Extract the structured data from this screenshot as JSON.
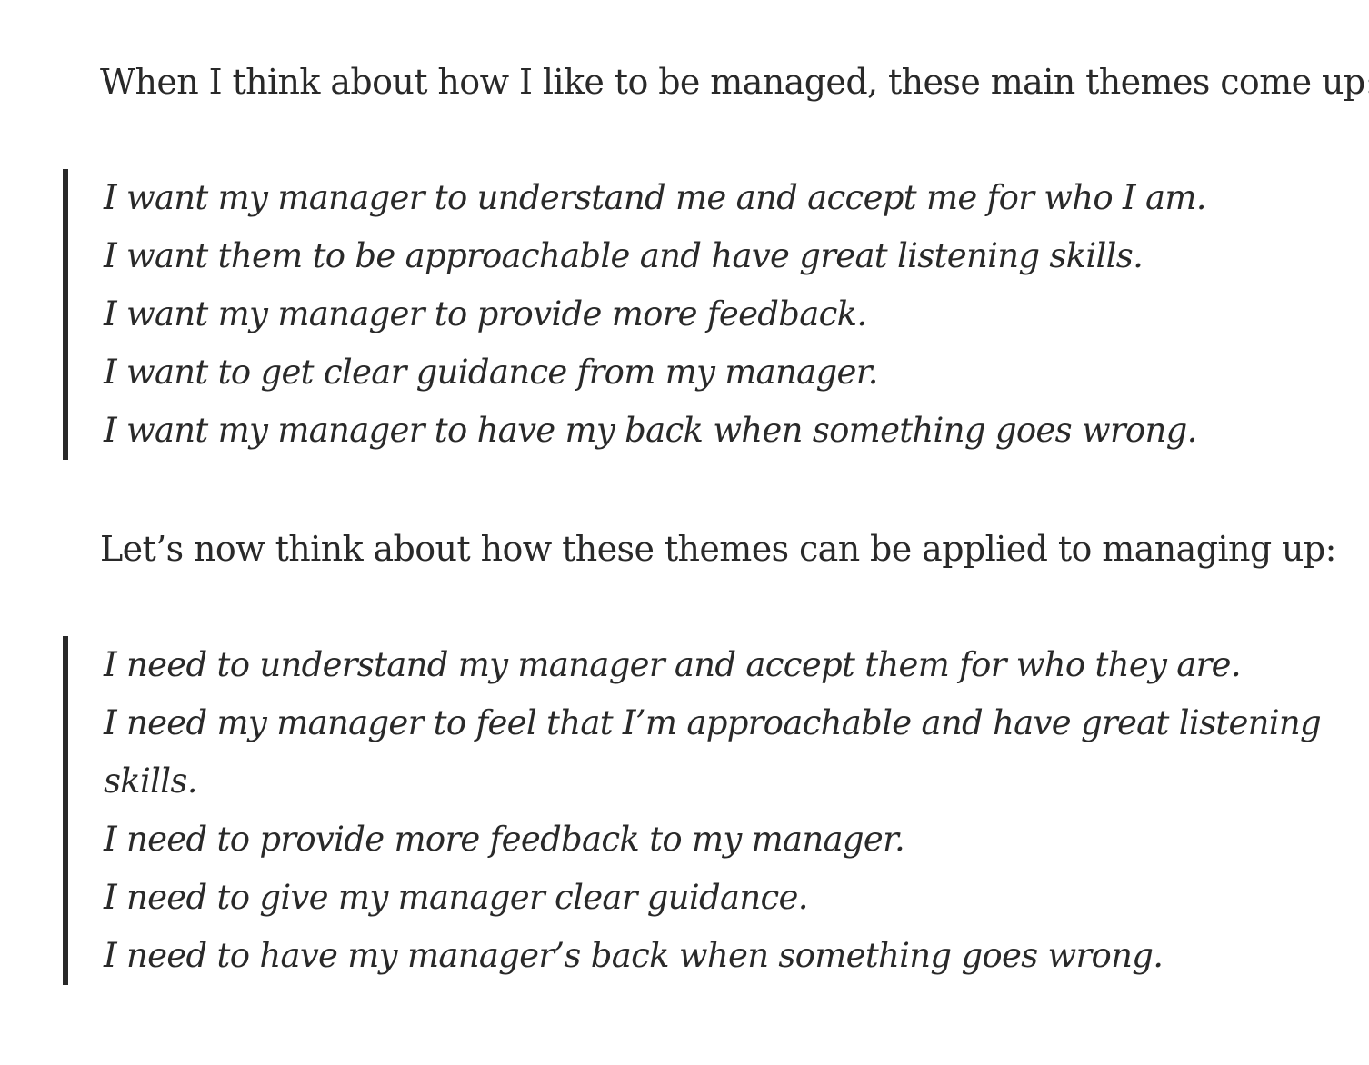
{
  "article": {
    "intro_paragraph": "When I think about how I like to be managed, these main themes come up:",
    "quote_one": [
      "I want my manager to understand me and accept me for who I am.",
      "I want them to be approachable and have great listening skills.",
      "I want my manager to provide more feedback.",
      "I want to get clear guidance from my manager.",
      "I want my manager to have my back when something goes wrong."
    ],
    "transition_paragraph": "Let’s now think about how these themes can be applied to managing up:",
    "quote_two": [
      "I need to understand my manager and accept them for who they are.",
      "I need my manager to feel that I’m approachable and have great listening",
      "skills.",
      "I need to provide more feedback to my manager.",
      "I need to give my manager clear guidance.",
      "I need to have my manager’s back when something goes wrong."
    ]
  }
}
